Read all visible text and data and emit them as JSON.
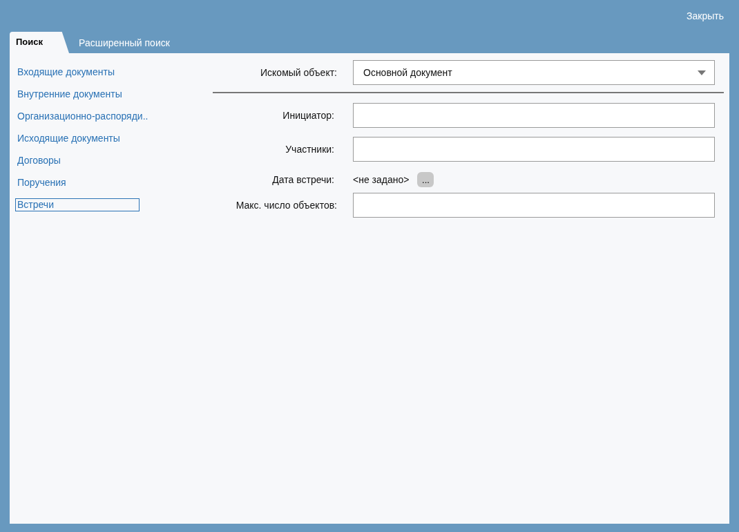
{
  "header": {
    "close_label": "Закрыть"
  },
  "tabs": [
    {
      "label": "Поиск",
      "selected": true
    },
    {
      "label": "Расширенный поиск",
      "selected": false
    }
  ],
  "sidebar": {
    "items": [
      {
        "label": "Входящие документы",
        "selected": false
      },
      {
        "label": "Внутренние документы",
        "selected": false
      },
      {
        "label": "Организационно-распоряди..",
        "selected": false
      },
      {
        "label": "Исходящие документы",
        "selected": false
      },
      {
        "label": "Договоры",
        "selected": false
      },
      {
        "label": "Поручения",
        "selected": false
      },
      {
        "label": "Встречи",
        "selected": true
      }
    ]
  },
  "object_field": {
    "label": "Искомый объект:",
    "value": "Основной документ"
  },
  "fields": [
    {
      "kind": "text",
      "label": "Инициатор:"
    },
    {
      "kind": "text",
      "label": "Участники:"
    },
    {
      "kind": "date",
      "label": "Дата встречи:",
      "value": "<не задано>",
      "button": "..."
    },
    {
      "kind": "text",
      "label": "Макс. число объектов:"
    }
  ]
}
